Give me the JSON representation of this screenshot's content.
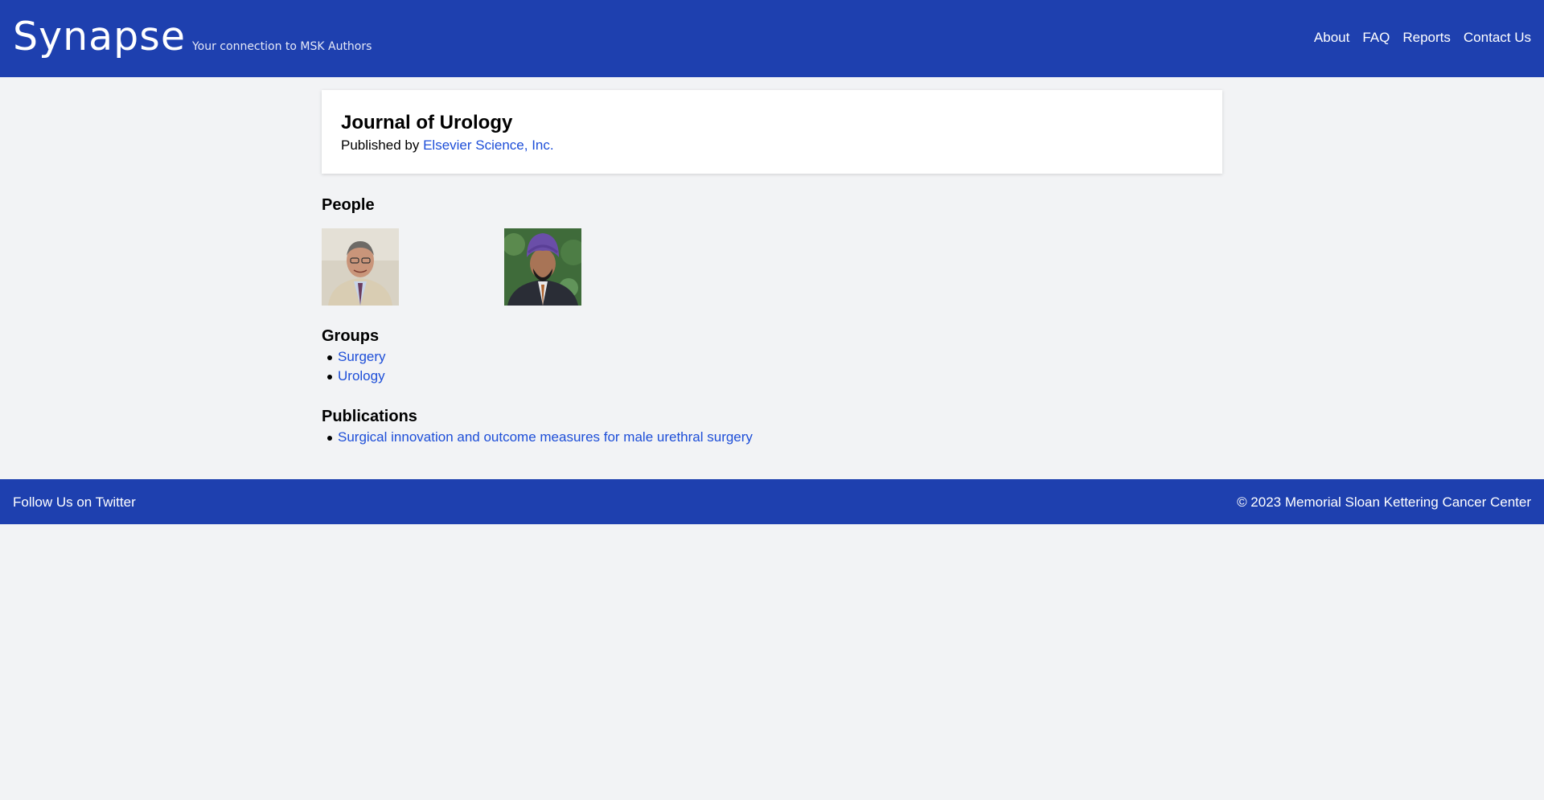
{
  "header": {
    "brand": "Synapse",
    "tagline": "Your connection to MSK Authors",
    "nav": [
      "About",
      "FAQ",
      "Reports",
      "Contact Us"
    ]
  },
  "journal": {
    "title": "Journal of Urology",
    "published_by_prefix": "Published by",
    "publisher": "Elsevier Science, Inc."
  },
  "people": {
    "heading": "People",
    "photos": [
      {
        "icon": "person-photo-icon"
      },
      {
        "icon": "person-photo-icon"
      }
    ]
  },
  "groups": {
    "heading": "Groups",
    "items": [
      "Surgery",
      "Urology"
    ]
  },
  "publications": {
    "heading": "Publications",
    "items": [
      "Surgical innovation and outcome measures for male urethral surgery"
    ]
  },
  "footer": {
    "twitter": "Follow Us on Twitter",
    "copyright": "© 2023 Memorial Sloan Kettering Cancer Center"
  },
  "colors": {
    "brand_blue": "#1e40af",
    "link_blue": "#1d4ed8",
    "page_bg": "#f2f3f5"
  }
}
